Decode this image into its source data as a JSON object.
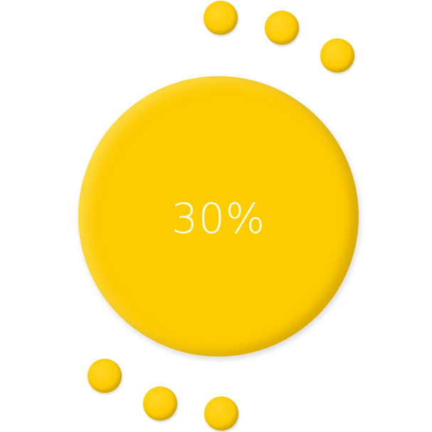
{
  "progress": {
    "label": "30%",
    "value": 0.3
  },
  "colors": {
    "accent": "#fccb00",
    "text": "#ffffff",
    "background": "#ffffff"
  }
}
